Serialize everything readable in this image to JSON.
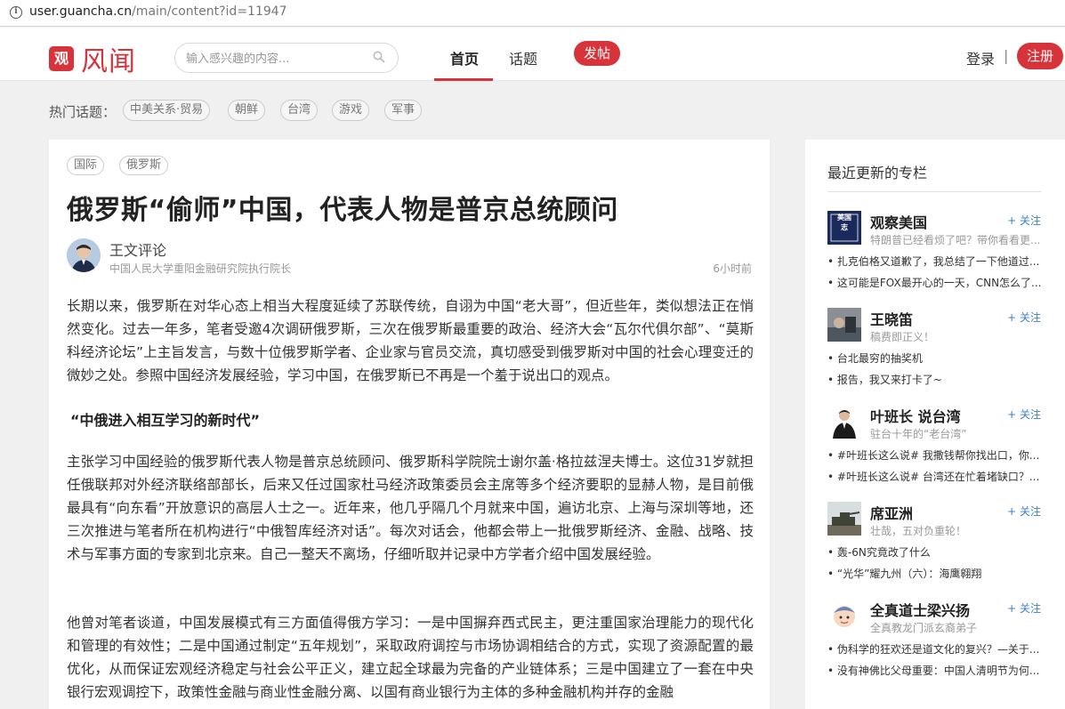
{
  "browser": {
    "url_host": "user.guancha.cn",
    "url_path": "/main/content?id=11947",
    "info_icon": "info-icon"
  },
  "header": {
    "logo_mark": "观",
    "logo_text": "风闻",
    "search_placeholder": "输入感兴趣的内容...",
    "nav": {
      "home": "首页",
      "topics": "话题"
    },
    "post_label": "发帖",
    "login_label": "登录",
    "separator": "|",
    "register_label": "注册",
    "accent_color": "#d6333a"
  },
  "hot_topics": {
    "label": "热门话题：",
    "tags": [
      "中美关系·贸易",
      "朝鲜",
      "台湾",
      "游戏",
      "军事"
    ]
  },
  "article": {
    "tags": [
      "国际",
      "俄罗斯"
    ],
    "title": "俄罗斯“偷师”中国，代表人物是普京总统顾问",
    "author_name": "王文评论",
    "author_desc": "中国人民大学重阳金融研究院执行院长",
    "time": "6小时前",
    "paragraphs": [
      "长期以来，俄罗斯在对华心态上相当大程度延续了苏联传统，自诩为中国“老大哥”，但近些年，类似想法正在悄然变化。过去一年多，笔者受邀4次调研俄罗斯，三次在俄罗斯最重要的政治、经济大会“瓦尔代俱尔部”、“莫斯科经济论坛”上主旨发言，与数十位俄罗斯学者、企业家与官员交流，真切感受到俄罗斯对中国的社会心理变迁的微妙之处。参照中国经济发展经验，学习中国，在俄罗斯已不再是一个羞于说出口的观点。",
      "主张学习中国经验的俄罗斯代表人物是普京总统顾问、俄罗斯科学院院士谢尔盖·格拉兹涅夫博士。这位31岁就担任俄联邦对外经济联络部部长，后来又任过国家杜马经济政策委员会主席等多个经济要职的显赫人物，是目前俄最具有“向东看”开放意识的高层人士之一。近年来，他几乎隔几个月就来中国，遍访北京、上海与深圳等地，还三次推进与笔者所在机构进行“中俄智库经济对话”。每次对话会，他都会带上一批俄罗斯经济、金融、战略、技术与军事方面的专家到北京来。自己一整天不离场，仔细听取并记录中方学者介绍中国发展经验。",
      "他曾对笔者谈道，中国发展模式有三方面值得俄方学习：一是中国摒弃西式民主，更注重国家治理能力的现代化和管理的有效性；二是中国通过制定“五年规划”，采取政府调控与市场协调相结合的方式，实现了资源配置的最优化，从而保证宏观经济稳定与社会公平正义，建立起全球最为完备的产业链体系；三是中国建立了一套在中央银行宏观调控下，政策性金融与商业性金融分离、以国有商业银行为主体的多种金融机构并存的金融"
    ],
    "subhead": "“中俄进入相互学习的新时代”"
  },
  "sidebar": {
    "title": "最近更新的专栏",
    "follow_label": "+ 关注",
    "columns": [
      {
        "name": "观察美国",
        "desc": "特朗普已经看烦了吧？带你看看更...",
        "links": [
          "扎克伯格又道歉了，我总结了一下他道过...",
          "这可能是FOX最开心的一天，CNN怎么了..."
        ],
        "avatar_text": "美国志"
      },
      {
        "name": "王晓笛",
        "desc": "稿费即正义！",
        "links": [
          "台北最穷的抽奖机",
          "报告，我又来打卡了~"
        ]
      },
      {
        "name": "叶班长 说台湾",
        "desc": "驻台十年的“老台湾”",
        "links": [
          "#叶班长这么说# 我撒钱帮你找出口，你...",
          "#叶班长这么说# 台湾还在忙着堵缺口？..."
        ]
      },
      {
        "name": "席亚洲",
        "desc": "壮哉，五对负重轮！",
        "links": [
          "轰-6N究竟改了什么",
          "“光华”耀九州（六）：海鹰翱翔"
        ]
      },
      {
        "name": "全真道士梁兴扬",
        "desc": "全真教龙门派玄裔弟子",
        "links": [
          "伪科学的狂欢还是道文化的复兴？—关于...",
          "没有神佛比父母重要：中国人清明节为何..."
        ]
      }
    ]
  }
}
